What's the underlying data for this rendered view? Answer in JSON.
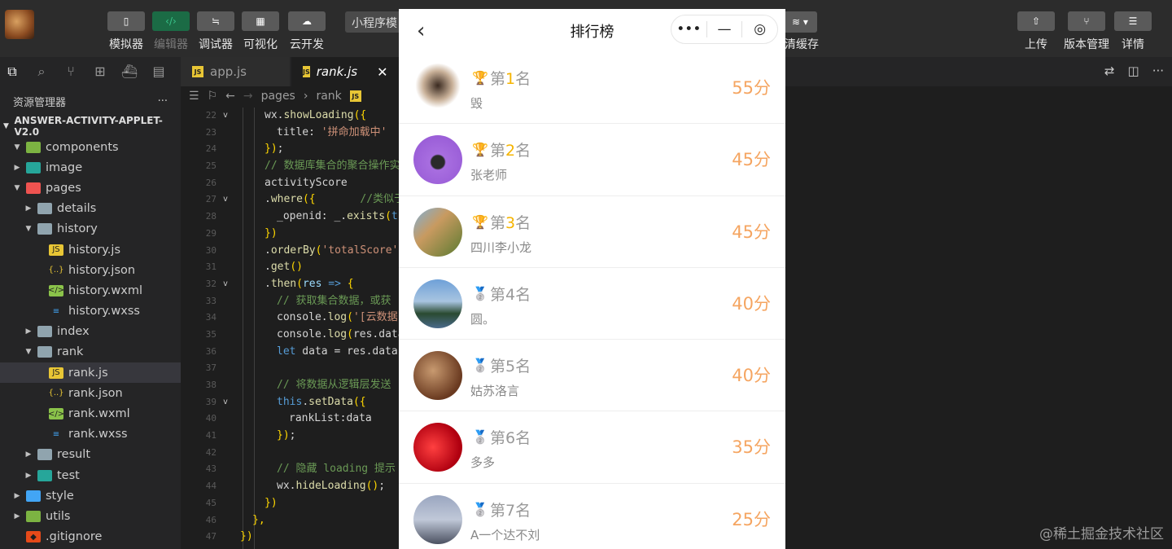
{
  "toolbar": {
    "buttons": [
      {
        "label": "模拟器",
        "icon": "phone-icon"
      },
      {
        "label": "编辑器",
        "icon": "code-icon"
      },
      {
        "label": "调试器",
        "icon": "debug-icon"
      },
      {
        "label": "可视化",
        "icon": "layout-icon"
      },
      {
        "label": "云开发",
        "icon": "cloud-icon"
      }
    ],
    "mode_select": "小程序模",
    "cache_label": "清缓存",
    "right_buttons": [
      {
        "label": "上传",
        "icon": "upload-icon"
      },
      {
        "label": "版本管理",
        "icon": "branch-icon"
      },
      {
        "label": "详情",
        "icon": "menu-icon"
      }
    ]
  },
  "explorer": {
    "header": "资源管理器",
    "more": "···",
    "root": "ANSWER-ACTIVITY-APPLET-V2.0",
    "tree": [
      {
        "name": "components",
        "arrow": "▼",
        "type": "folder-green"
      },
      {
        "name": "image",
        "arrow": "▶",
        "type": "folder-teal"
      },
      {
        "name": "pages",
        "arrow": "▼",
        "type": "folder-red"
      },
      {
        "name": "details",
        "arrow": "▶",
        "type": "folder"
      },
      {
        "name": "history",
        "arrow": "▼",
        "type": "folder-open"
      },
      {
        "name": "history.js",
        "arrow": "",
        "type": "js"
      },
      {
        "name": "history.json",
        "arrow": "",
        "type": "json"
      },
      {
        "name": "history.wxml",
        "arrow": "",
        "type": "wxml"
      },
      {
        "name": "history.wxss",
        "arrow": "",
        "type": "wxss"
      },
      {
        "name": "index",
        "arrow": "▶",
        "type": "folder"
      },
      {
        "name": "rank",
        "arrow": "▼",
        "type": "folder-open"
      },
      {
        "name": "rank.js",
        "arrow": "",
        "type": "js"
      },
      {
        "name": "rank.json",
        "arrow": "",
        "type": "json"
      },
      {
        "name": "rank.wxml",
        "arrow": "",
        "type": "wxml"
      },
      {
        "name": "rank.wxss",
        "arrow": "",
        "type": "wxss"
      },
      {
        "name": "result",
        "arrow": "▶",
        "type": "folder"
      },
      {
        "name": "test",
        "arrow": "▶",
        "type": "folder-teal"
      },
      {
        "name": "style",
        "arrow": "▶",
        "type": "folder-blue"
      },
      {
        "name": "utils",
        "arrow": "▶",
        "type": "folder-green"
      },
      {
        "name": ".gitignore",
        "arrow": "",
        "type": "git"
      }
    ]
  },
  "tabs": [
    {
      "label": "app.js",
      "active": false
    },
    {
      "label": "rank.js",
      "active": true,
      "close": "✕"
    }
  ],
  "breadcrumb": {
    "path1": "pages",
    "sep": "›",
    "path2": "rank",
    "js": "JS"
  },
  "editor": {
    "lines": [
      {
        "n": "22",
        "fold": "v",
        "ind": 1,
        "parts": [
          [
            "t-pl",
            "wx."
          ],
          [
            "t-fn",
            "showLoading"
          ],
          [
            "t-p",
            "({"
          ]
        ]
      },
      {
        "n": "23",
        "fold": "",
        "ind": 2,
        "parts": [
          [
            "t-pl",
            "title: "
          ],
          [
            "t-str",
            "'拼命加载中'"
          ]
        ]
      },
      {
        "n": "24",
        "fold": "",
        "ind": 1,
        "parts": [
          [
            "t-p",
            "})"
          ],
          [
            "t-pl",
            ";"
          ]
        ]
      },
      {
        "n": "25",
        "fold": "",
        "ind": 1,
        "parts": [
          [
            "t-cm",
            "// 数据库集合的聚合操作实"
          ]
        ]
      },
      {
        "n": "26",
        "fold": "",
        "ind": 1,
        "parts": [
          [
            "t-pl",
            "activityScore"
          ]
        ]
      },
      {
        "n": "27",
        "fold": "v",
        "ind": 1,
        "parts": [
          [
            "t-pl",
            "."
          ],
          [
            "t-fn",
            "where"
          ],
          [
            "t-p",
            "({"
          ],
          [
            "t-cm",
            "       //类似于"
          ]
        ]
      },
      {
        "n": "28",
        "fold": "",
        "ind": 2,
        "parts": [
          [
            "t-pl",
            "_openid: _."
          ],
          [
            "t-fn",
            "exists"
          ],
          [
            "t-p",
            "("
          ],
          [
            "t-kw",
            "tr"
          ]
        ]
      },
      {
        "n": "29",
        "fold": "",
        "ind": 1,
        "parts": [
          [
            "t-p",
            "})"
          ]
        ]
      },
      {
        "n": "30",
        "fold": "",
        "ind": 1,
        "parts": [
          [
            "t-pl",
            "."
          ],
          [
            "t-fn",
            "orderBy"
          ],
          [
            "t-p",
            "("
          ],
          [
            "t-str",
            "'totalScore'"
          ],
          [
            "t-pl",
            ","
          ]
        ]
      },
      {
        "n": "31",
        "fold": "",
        "ind": 1,
        "parts": [
          [
            "t-pl",
            "."
          ],
          [
            "t-fn",
            "get"
          ],
          [
            "t-p",
            "()"
          ]
        ]
      },
      {
        "n": "32",
        "fold": "v",
        "ind": 1,
        "parts": [
          [
            "t-pl",
            "."
          ],
          [
            "t-fn",
            "then"
          ],
          [
            "t-p",
            "("
          ],
          [
            "t-var",
            "res"
          ],
          [
            "t-kw",
            " =>"
          ],
          [
            "t-p",
            " {"
          ]
        ]
      },
      {
        "n": "33",
        "fold": "",
        "ind": 2,
        "parts": [
          [
            "t-cm",
            "// 获取集合数据，或获"
          ]
        ]
      },
      {
        "n": "34",
        "fold": "",
        "ind": 2,
        "parts": [
          [
            "t-pl",
            "console."
          ],
          [
            "t-fn",
            "log"
          ],
          [
            "t-p",
            "("
          ],
          [
            "t-str",
            "'[云数据"
          ]
        ]
      },
      {
        "n": "35",
        "fold": "",
        "ind": 2,
        "parts": [
          [
            "t-pl",
            "console."
          ],
          [
            "t-fn",
            "log"
          ],
          [
            "t-p",
            "("
          ],
          [
            "t-pl",
            "res.data"
          ]
        ]
      },
      {
        "n": "36",
        "fold": "",
        "ind": 2,
        "parts": [
          [
            "t-kw",
            "let"
          ],
          [
            "t-pl",
            " data = res.data"
          ]
        ]
      },
      {
        "n": "37",
        "fold": "",
        "ind": 0,
        "parts": []
      },
      {
        "n": "38",
        "fold": "",
        "ind": 2,
        "parts": [
          [
            "t-cm",
            "// 将数据从逻辑层发送"
          ]
        ]
      },
      {
        "n": "39",
        "fold": "v",
        "ind": 2,
        "parts": [
          [
            "t-kw",
            "this"
          ],
          [
            "t-pl",
            "."
          ],
          [
            "t-fn",
            "setData"
          ],
          [
            "t-p",
            "({"
          ]
        ]
      },
      {
        "n": "40",
        "fold": "",
        "ind": 3,
        "parts": [
          [
            "t-pl",
            "rankList:data"
          ]
        ]
      },
      {
        "n": "41",
        "fold": "",
        "ind": 2,
        "parts": [
          [
            "t-p",
            "})"
          ],
          [
            "t-pl",
            ";"
          ]
        ]
      },
      {
        "n": "42",
        "fold": "",
        "ind": 0,
        "parts": []
      },
      {
        "n": "43",
        "fold": "",
        "ind": 2,
        "parts": [
          [
            "t-cm",
            "// 隐藏 loading 提示"
          ]
        ]
      },
      {
        "n": "44",
        "fold": "",
        "ind": 2,
        "parts": [
          [
            "t-pl",
            "wx."
          ],
          [
            "t-fn",
            "hideLoading"
          ],
          [
            "t-p",
            "()"
          ],
          [
            "t-pl",
            ";"
          ]
        ]
      },
      {
        "n": "45",
        "fold": "",
        "ind": 1,
        "parts": [
          [
            "t-p",
            "})"
          ]
        ]
      },
      {
        "n": "46",
        "fold": "",
        "ind": 0,
        "parts": [
          [
            "t-p",
            "},"
          ]
        ]
      },
      {
        "n": "47",
        "fold": "",
        "ind": -1,
        "parts": [
          [
            "t-p",
            "})"
          ]
        ]
      }
    ]
  },
  "phone": {
    "back": "‹",
    "title": "排行榜",
    "capsule": {
      "more": "•••",
      "minimize": "—",
      "close": "◎"
    },
    "ranks": [
      {
        "medal": "🏆",
        "prefix": "第",
        "num": "1",
        "suffix": "名",
        "nickname": "毁",
        "score": "55分",
        "gold": true,
        "avatar": "radial-gradient(circle at 50% 45%, #3a2a20, #c8b098 40%, #ffffff 62%)"
      },
      {
        "medal": "🏆",
        "prefix": "第",
        "num": "2",
        "suffix": "名",
        "nickname": "张老师",
        "score": "45分",
        "gold": true,
        "avatar": "radial-gradient(circle at 50% 55%, #2a2a2a 18%, #a86ee0 22%, #9b5fd8 70%)"
      },
      {
        "medal": "🏆",
        "prefix": "第",
        "num": "3",
        "suffix": "名",
        "nickname": "四川李小龙",
        "score": "45分",
        "gold": true,
        "avatar": "linear-gradient(135deg, #7fb0d8 0%, #c89a60 40%, #5a7a30 100%)"
      },
      {
        "medal": "🥈",
        "prefix": "第",
        "num": "4",
        "suffix": "名",
        "nickname": "圆。",
        "score": "40分",
        "gold": false,
        "avatar": "linear-gradient(180deg, #6ea0d8 0%, #a8c4e0 45%, #2a4a30 70%, #4a6a8a 100%)"
      },
      {
        "medal": "🥈",
        "prefix": "第",
        "num": "5",
        "suffix": "名",
        "nickname": "姑苏洛言",
        "score": "40分",
        "gold": false,
        "avatar": "radial-gradient(circle at 40% 40%, #c89a70, #6a3a20 70%)"
      },
      {
        "medal": "🥈",
        "prefix": "第",
        "num": "6",
        "suffix": "名",
        "nickname": "多多",
        "score": "35分",
        "gold": false,
        "avatar": "radial-gradient(circle at 40% 50%, #ff4040, #b00010 70%)"
      },
      {
        "medal": "🥈",
        "prefix": "第",
        "num": "7",
        "suffix": "名",
        "nickname": "A一个达不刘",
        "score": "25分",
        "gold": false,
        "avatar": "linear-gradient(180deg, #9aa6c0 0%, #c0c8d8 50%, #4a5060 100%)"
      }
    ]
  },
  "watermark": "@稀土掘金技术社区"
}
